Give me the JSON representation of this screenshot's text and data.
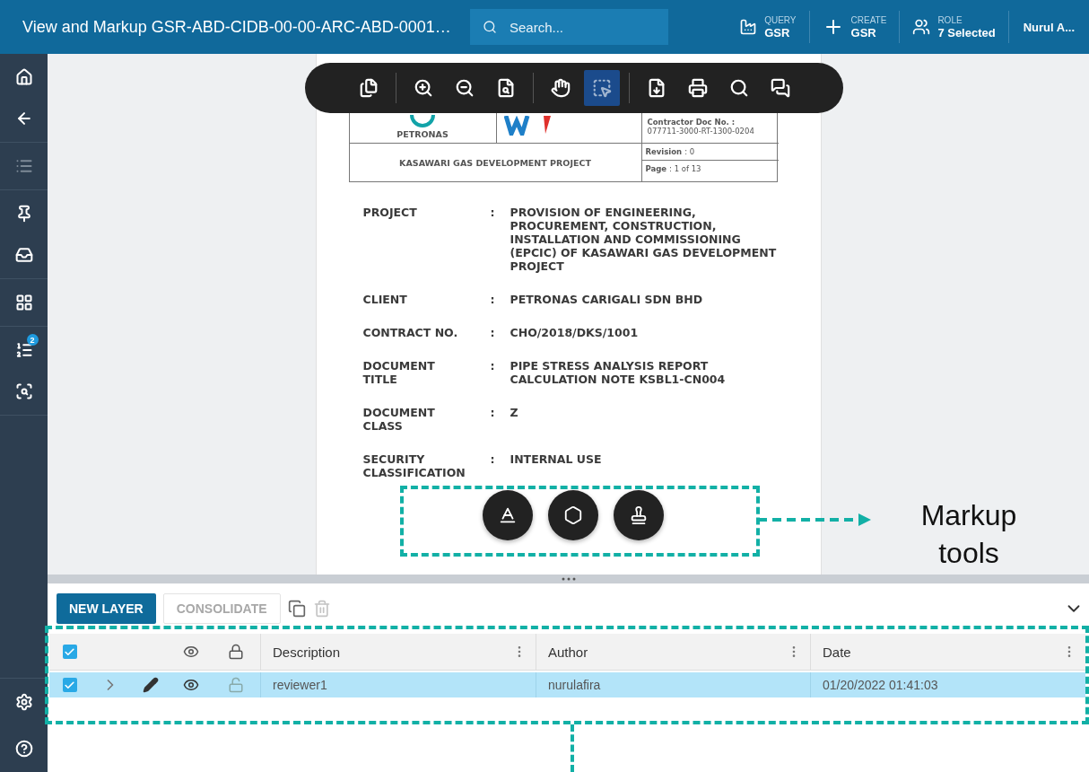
{
  "header": {
    "title": "View and Markup GSR-ABD-CIDB-00-00-ARC-ABD-0001…",
    "search": {
      "placeholder": "Search..."
    },
    "actions": [
      {
        "kind": "query",
        "caption": "QUERY",
        "value": "GSR"
      },
      {
        "kind": "create",
        "caption": "CREATE",
        "value": "GSR"
      },
      {
        "kind": "role",
        "caption": "ROLE",
        "value": "7 Selected"
      }
    ],
    "user": "Nurul A..."
  },
  "sidebar": {
    "groups": [
      [
        {
          "kind": "home",
          "disabled": false
        },
        {
          "kind": "back",
          "disabled": false
        }
      ],
      [
        {
          "kind": "list",
          "disabled": true
        }
      ],
      [
        {
          "kind": "pin",
          "disabled": false
        },
        {
          "kind": "inbox",
          "disabled": false
        }
      ],
      [
        {
          "kind": "grid",
          "disabled": false
        }
      ],
      [
        {
          "kind": "numbered",
          "disabled": false,
          "badge": "2"
        },
        {
          "kind": "chart",
          "disabled": false
        }
      ]
    ],
    "bottom": [
      {
        "kind": "settings",
        "disabled": false
      },
      {
        "kind": "help",
        "disabled": false
      }
    ]
  },
  "toolbar": {
    "groups": [
      [
        {
          "selected": false
        }
      ],
      [
        {
          "selected": false
        },
        {
          "selected": false
        },
        {
          "selected": false
        }
      ],
      [
        {
          "selected": false
        },
        {
          "selected": true
        }
      ],
      [
        {
          "selected": false
        },
        {
          "selected": false
        },
        {
          "selected": false
        },
        {
          "selected": false
        }
      ]
    ]
  },
  "document": {
    "logo_caption": "PETRONAS",
    "contractor_label": "Contractor Doc No. :",
    "contractor_no": "077711-3000-RT-1300-0204",
    "project_name": "KASAWARI GAS DEVELOPMENT PROJECT",
    "revision": {
      "label": "Revision",
      "value": ": 0"
    },
    "page": {
      "label": "Page",
      "value": ": 1 of 13"
    },
    "fields": [
      {
        "label": "PROJECT",
        "colon": ":",
        "value": "PROVISION OF ENGINEERING, PROCUREMENT, CONSTRUCTION, INSTALLATION AND COMMISSIONING (EPCIC) OF KASAWARI GAS DEVELOPMENT PROJECT"
      },
      {
        "label": "CLIENT",
        "colon": ":",
        "value": "PETRONAS CARIGALI SDN BHD"
      },
      {
        "label": "CONTRACT NO.",
        "colon": ":",
        "value": "CHO/2018/DKS/1001"
      },
      {
        "label": "DOCUMENT TITLE",
        "colon": ":",
        "value": "PIPE STRESS ANALYSIS REPORT CALCULATION NOTE KSBL1-CN004"
      },
      {
        "label": "DOCUMENT CLASS",
        "colon": ":",
        "value": "Z"
      },
      {
        "label": "SECURITY CLASSIFICATION",
        "colon": ":",
        "value": "INTERNAL USE"
      }
    ]
  },
  "layers": {
    "buttons": [
      {
        "label": "NEW LAYER",
        "disabled": false
      },
      {
        "label": "CONSOLIDATE",
        "disabled": true
      }
    ],
    "copy_disabled": false,
    "delete_disabled": true,
    "all_checked": true,
    "columns": [
      "Description",
      "Author",
      "Date"
    ],
    "rows": [
      {
        "checked": true,
        "selected": true,
        "visible": true,
        "locked": false,
        "cells": [
          "reviewer1",
          "nurulafira",
          "01/20/2022 01:41:03"
        ]
      }
    ]
  },
  "annotation": {
    "label": "Markup tools"
  }
}
